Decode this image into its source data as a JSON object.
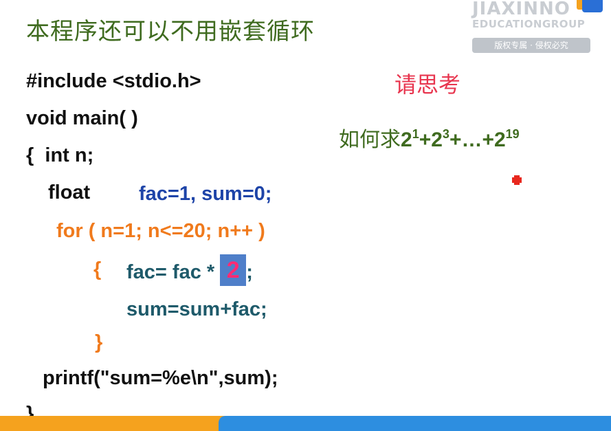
{
  "title": "本程序还可以不用嵌套循环",
  "watermark": {
    "line1": "JIAXINNO",
    "line2": "EDUCATIONGROUP",
    "badge": "版权专属 · 侵权必究"
  },
  "code": {
    "line1": "#include <stdio.h>",
    "line2": "void main( )",
    "line3": "{  int n;",
    "line4_keyword": "float",
    "line4_decl": "fac=1, sum=0;",
    "line5": "for ( n=1; n<=20; n++ )",
    "line6_brace": "{",
    "line6_pre": "fac= fac * ",
    "line6_highlight": "2",
    "line6_post": ";",
    "line7": "sum=sum+fac;",
    "line8": "}",
    "line9": "printf(\"sum=%e\\n\",sum);",
    "line10": "}"
  },
  "hint": {
    "think": "请思考",
    "question_prefix": "如何求",
    "term1_base": "2",
    "term1_exp": "1",
    "plus1": "+",
    "term2_base": "2",
    "term2_exp": "3",
    "middle": "+…+",
    "term3_base": "2",
    "term3_exp": "19"
  },
  "colors": {
    "title_green": "#3f6b1f",
    "code_black": "#111111",
    "code_blue": "#1e44a8",
    "code_orange": "#f07a1c",
    "code_teal": "#1e5a6a",
    "highlight_bg": "#4f7fc9",
    "highlight_text": "#ff2b73",
    "think_red": "#e8364f",
    "footer_orange": "#f5a21e",
    "footer_blue": "#2d8ee0"
  }
}
